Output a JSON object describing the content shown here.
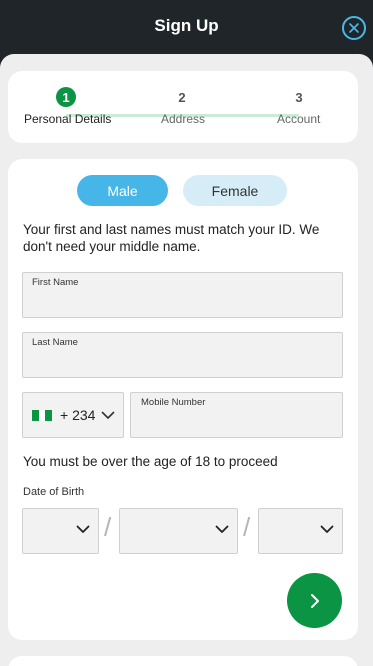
{
  "header": {
    "title": "Sign Up"
  },
  "icons": {
    "close": "close-icon",
    "chevron": "chevron-down-icon",
    "next": "chevron-right-icon",
    "flag": "nigeria-flag-icon"
  },
  "colors": {
    "primary_green": "#0a9444",
    "accent_blue": "#46b5e8",
    "light_blue": "#d6edf8",
    "dark_bg": "#1f2529"
  },
  "stepper": {
    "steps": [
      {
        "number": "1",
        "label": "Personal Details",
        "active": true
      },
      {
        "number": "2",
        "label": "Address",
        "active": false
      },
      {
        "number": "3",
        "label": "Account",
        "active": false
      }
    ]
  },
  "form": {
    "gender": {
      "male": "Male",
      "female": "Female",
      "selected": "Male"
    },
    "name_notice": "Your first and last names must match your ID. We don't need your middle name.",
    "first_name": {
      "label": "First Name",
      "value": ""
    },
    "last_name": {
      "label": "Last Name",
      "value": ""
    },
    "phone": {
      "country_code": "+ 234",
      "label": "Mobile Number",
      "value": ""
    },
    "age_notice": "You must be over the age of 18 to proceed",
    "dob": {
      "label": "Date of Birth",
      "separator": "/"
    }
  }
}
